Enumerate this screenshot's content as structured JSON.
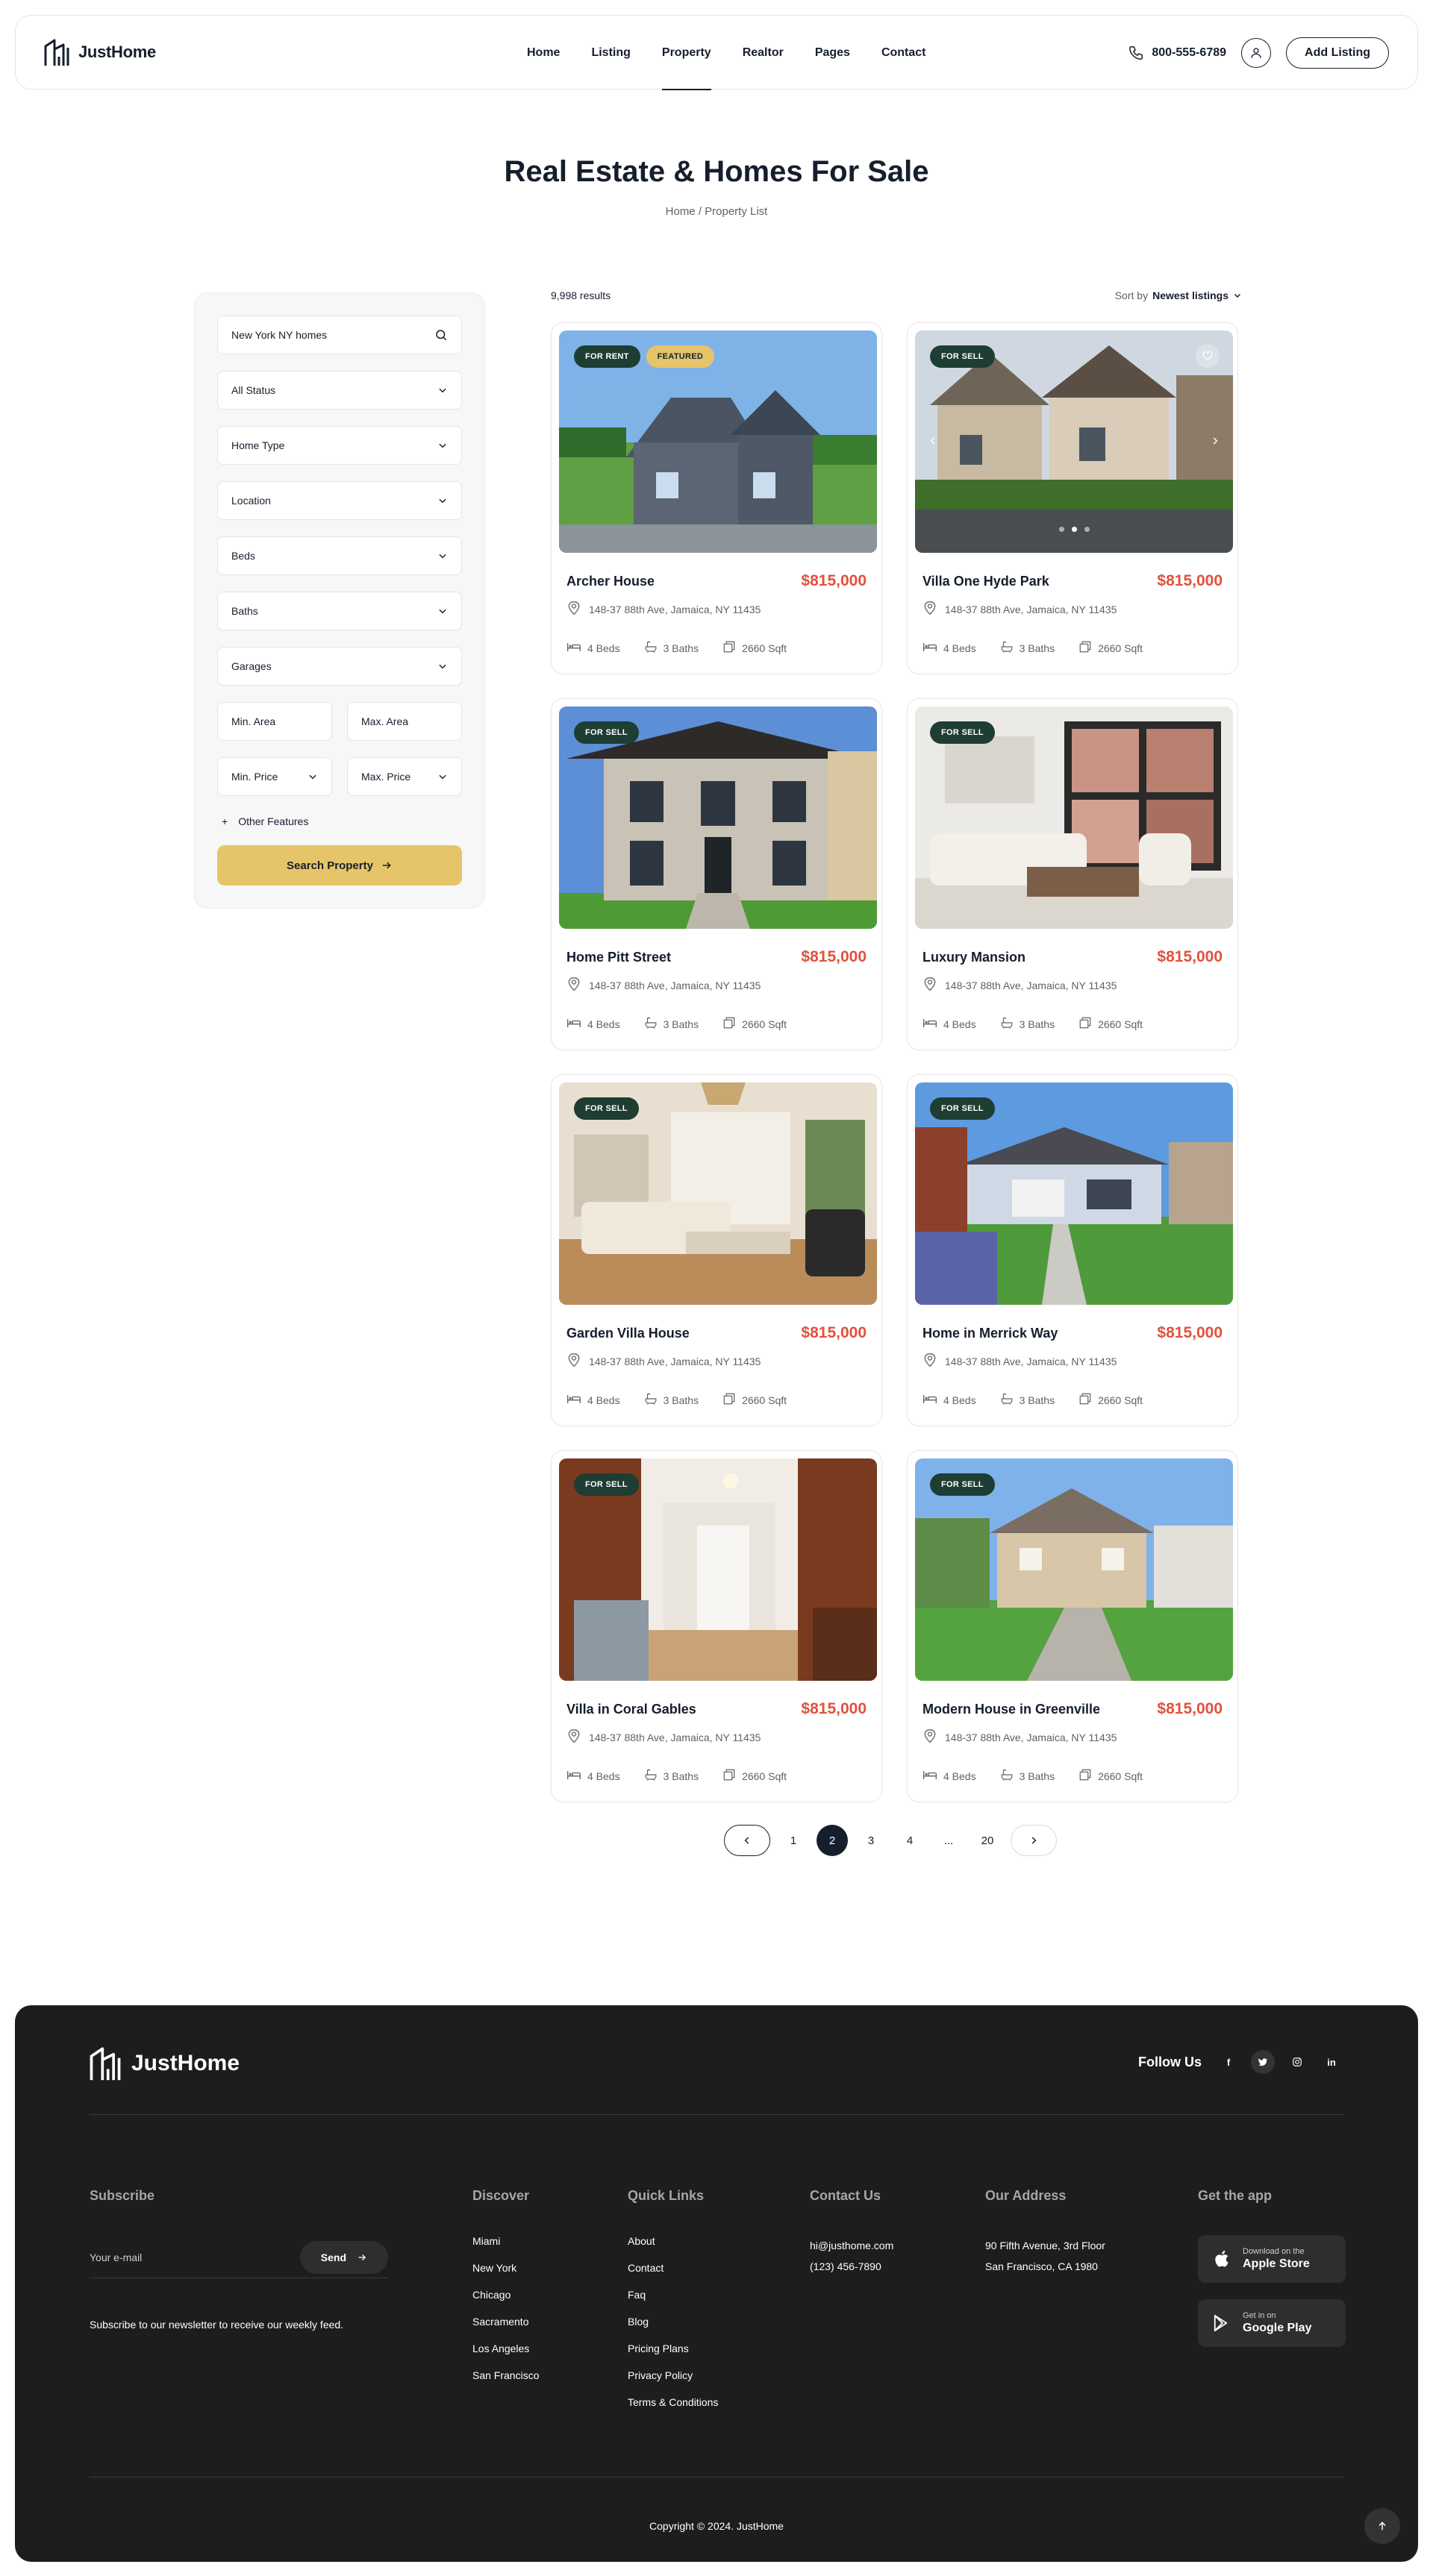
{
  "header": {
    "brand": "JustHome",
    "nav": [
      "Home",
      "Listing",
      "Property",
      "Realtor",
      "Pages",
      "Contact"
    ],
    "active_nav": "Property",
    "phone": "800-555-6789",
    "add_listing": "Add Listing"
  },
  "page": {
    "title": "Real Estate & Homes For Sale",
    "breadcrumb": "Home / Property List"
  },
  "sidebar": {
    "search_value": "New York NY homes",
    "status": "All Status",
    "home_type": "Home Type",
    "location": "Location",
    "beds": "Beds",
    "baths": "Baths",
    "garages": "Garages",
    "min_area": "Min. Area",
    "max_area": "Max. Area",
    "min_price": "Min. Price",
    "max_price": "Max. Price",
    "other_features": "Other Features",
    "search_button": "Search Property"
  },
  "results": {
    "count": "9,998 results",
    "sort_label": "Sort by",
    "sort_value": "Newest listings"
  },
  "listings": [
    {
      "title": "Archer House",
      "price": "$815,000",
      "address": "148-37 88th Ave, Jamaica, NY 11435",
      "beds": "4 Beds",
      "baths": "3 Baths",
      "area": "2660 Sqft",
      "badges": [
        "FOR RENT",
        "FEATURED"
      ]
    },
    {
      "title": "Villa One Hyde Park",
      "price": "$815,000",
      "address": "148-37 88th Ave, Jamaica, NY 11435",
      "beds": "4 Beds",
      "baths": "3 Baths",
      "area": "2660 Sqft",
      "badges": [
        "FOR SELL"
      ]
    },
    {
      "title": "Home Pitt Street",
      "price": "$815,000",
      "address": "148-37 88th Ave, Jamaica, NY 11435",
      "beds": "4 Beds",
      "baths": "3 Baths",
      "area": "2660 Sqft",
      "badges": [
        "FOR SELL"
      ]
    },
    {
      "title": "Luxury Mansion",
      "price": "$815,000",
      "address": "148-37 88th Ave, Jamaica, NY 11435",
      "beds": "4 Beds",
      "baths": "3 Baths",
      "area": "2660 Sqft",
      "badges": [
        "FOR SELL"
      ]
    },
    {
      "title": "Garden Villa House",
      "price": "$815,000",
      "address": "148-37 88th Ave, Jamaica, NY 11435",
      "beds": "4 Beds",
      "baths": "3 Baths",
      "area": "2660 Sqft",
      "badges": [
        "FOR SELL"
      ]
    },
    {
      "title": "Home in Merrick Way",
      "price": "$815,000",
      "address": "148-37 88th Ave, Jamaica, NY 11435",
      "beds": "4 Beds",
      "baths": "3 Baths",
      "area": "2660 Sqft",
      "badges": [
        "FOR SELL"
      ]
    },
    {
      "title": "Villa in Coral Gables",
      "price": "$815,000",
      "address": "148-37 88th Ave, Jamaica, NY 11435",
      "beds": "4 Beds",
      "baths": "3 Baths",
      "area": "2660 Sqft",
      "badges": [
        "FOR SELL"
      ]
    },
    {
      "title": "Modern House in Greenville",
      "price": "$815,000",
      "address": "148-37 88th Ave, Jamaica, NY 11435",
      "beds": "4 Beds",
      "baths": "3 Baths",
      "area": "2660 Sqft",
      "badges": [
        "FOR SELL"
      ]
    }
  ],
  "pagination": {
    "pages": [
      "1",
      "2",
      "3",
      "4",
      "...",
      "20"
    ],
    "current": "2"
  },
  "footer": {
    "brand": "JustHome",
    "follow_label": "Follow Us",
    "subscribe": {
      "heading": "Subscribe",
      "placeholder": "Your e-mail",
      "send": "Send",
      "note": "Subscribe to our newsletter to receive our weekly feed."
    },
    "discover": {
      "heading": "Discover",
      "links": [
        "Miami",
        "New York",
        "Chicago",
        "Sacramento",
        "Los Angeles",
        "San Francisco"
      ]
    },
    "quick_links": {
      "heading": "Quick Links",
      "links": [
        "About",
        "Contact",
        "Faq",
        "Blog",
        "Pricing Plans",
        "Privacy Policy",
        "Terms & Conditions"
      ]
    },
    "contact": {
      "heading": "Contact Us",
      "email": "hi@justhome.com",
      "phone": "(123) 456-7890"
    },
    "address": {
      "heading": "Our Address",
      "line1": "90 Fifth Avenue, 3rd Floor",
      "line2": "San Francisco, CA 1980"
    },
    "app": {
      "heading": "Get the app",
      "apple_small": "Download on the",
      "apple_big": "Apple Store",
      "google_small": "Get in on",
      "google_big": "Google Play"
    },
    "copyright": "Copyright © 2024. JustHome"
  },
  "colors": {
    "accent_yellow": "#e6c46a",
    "price_red": "#e0523d",
    "badge_green": "#1e3d33",
    "footer_bg": "#1d1d1d"
  }
}
